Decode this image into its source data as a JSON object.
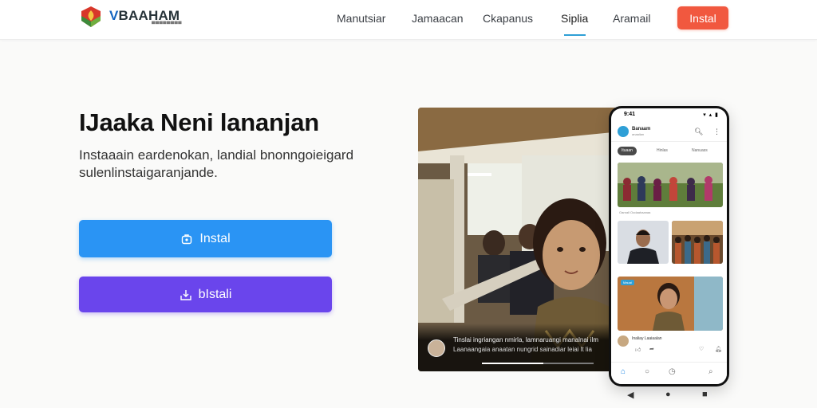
{
  "header": {
    "brand_prefix": "V",
    "brand_name": "BAAHAM",
    "brand_sub": "▀▀▀▀▀▀▀▀",
    "nav": [
      "Manutsiar",
      "Jamaacan",
      "Ckapanus",
      "Siplia",
      "Aramail"
    ],
    "active_nav_index": 3,
    "install_label": "Instal"
  },
  "hero": {
    "title": "IJaaka Neni lananjan",
    "description": "Instaaain eardenokan, landial bnonngoieigard sulenlinstaigaranjande.",
    "primary_button": "Instal",
    "secondary_button": "bIstali"
  },
  "video": {
    "caption_line1": "Tinslai ingriangan nmirla, lamnaruangi manalnai ilm",
    "caption_line2": "Laanaangaia anaatan nungrid sainadiar leiai lt lia",
    "progress": 0.55
  },
  "phone": {
    "time": "9:41",
    "status_icons": "▾ ▴ ▮",
    "app_name": "Banaam",
    "app_sub": "anaaiian",
    "chips": [
      "Ituaan",
      "Hinlas",
      "Nanuass"
    ],
    "meta_1": "Oanrall  Oodaahaanaa",
    "badge": "Mauai",
    "post_title": "Inaliay Laaiaalan",
    "colors": {
      "accent": "#1e88e5"
    }
  },
  "colors": {
    "install_orange": "#f1583f",
    "cta_blue": "#2a94f4",
    "cta_purple": "#6a45ec",
    "nav_active": "#2f9fd6"
  }
}
